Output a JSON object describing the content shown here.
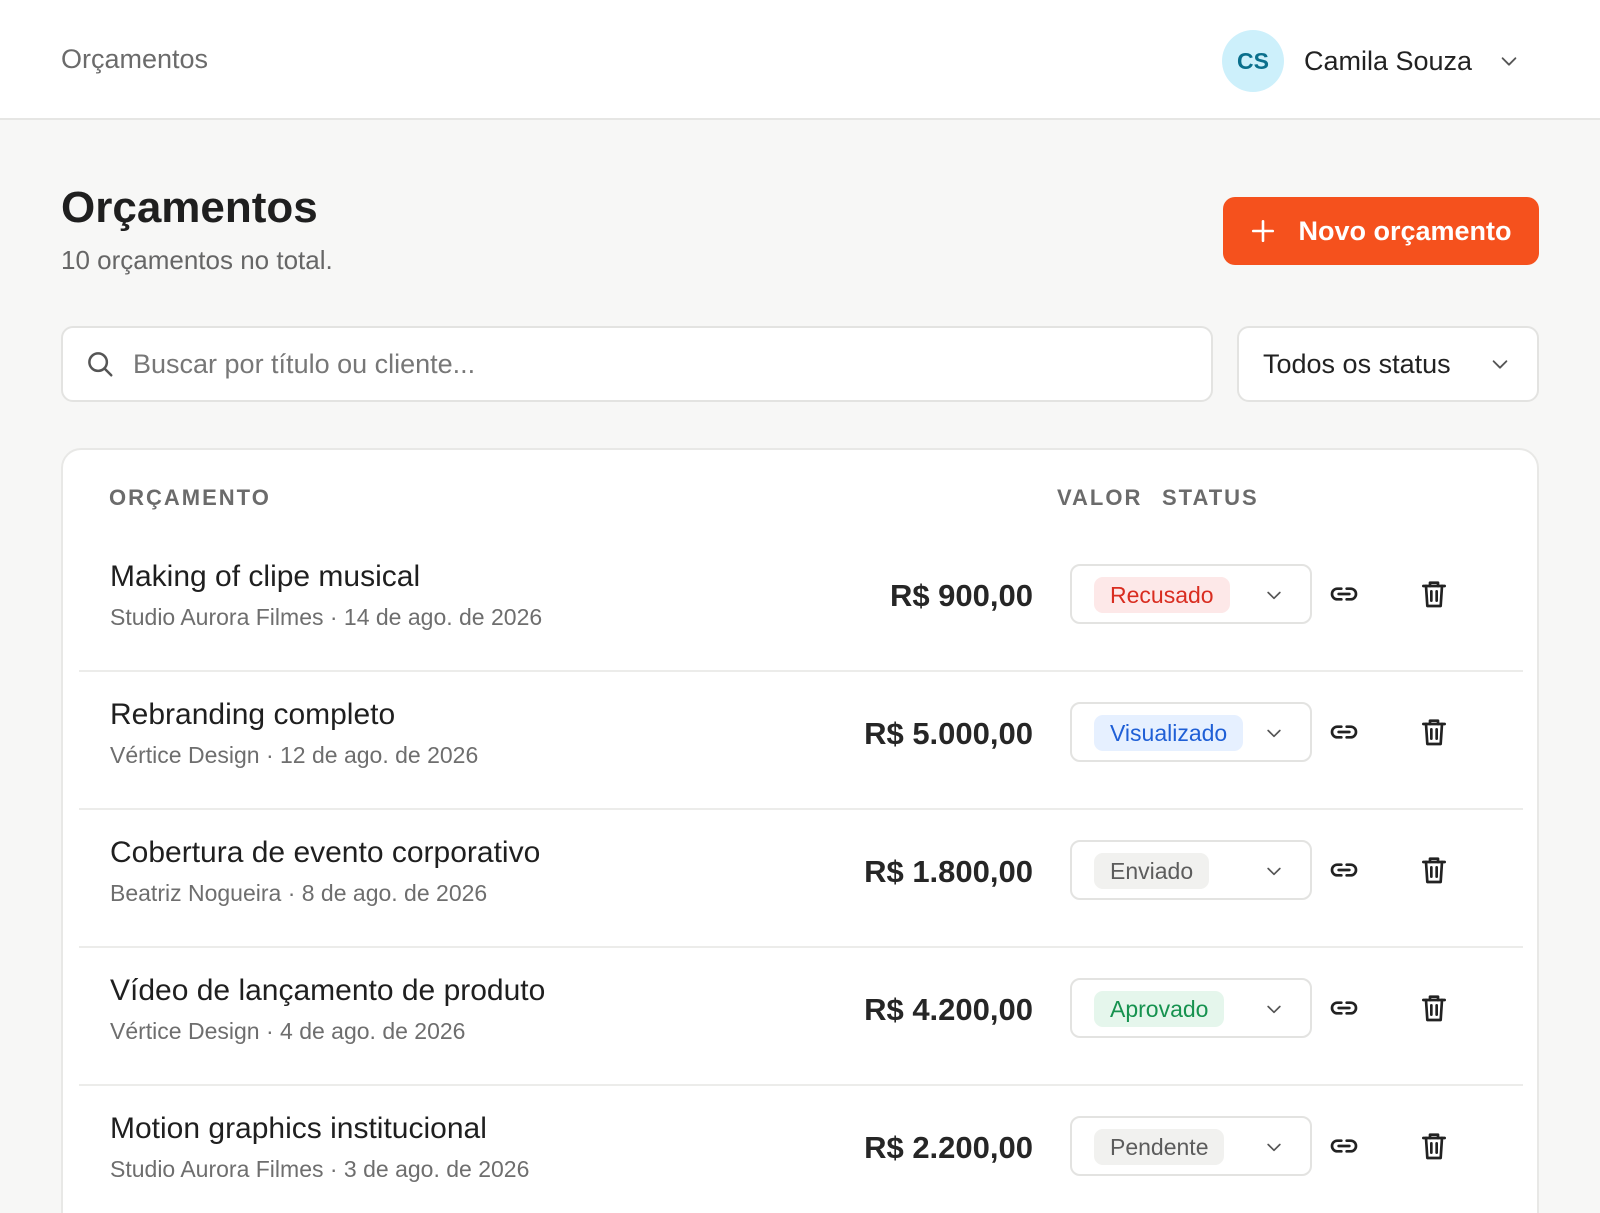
{
  "topbar": {
    "breadcrumb": "Orçamentos",
    "user": {
      "initials": "CS",
      "name": "Camila Souza"
    }
  },
  "header": {
    "title": "Orçamentos",
    "subtitle": "10 orçamentos no total.",
    "new_button_label": "Novo orçamento"
  },
  "filters": {
    "search_placeholder": "Buscar por título ou cliente...",
    "status_selected": "Todos os status"
  },
  "table": {
    "columns": {
      "quote": "ORÇAMENTO",
      "value": "VALOR",
      "status": "STATUS"
    },
    "rows": [
      {
        "title": "Making of clipe musical",
        "meta": "Studio Aurora Filmes · 14 de ago. de 2026",
        "value": "R$ 900,00",
        "status": "Recusado"
      },
      {
        "title": "Rebranding completo",
        "meta": "Vértice Design · 12 de ago. de 2026",
        "value": "R$ 5.000,00",
        "status": "Visualizado"
      },
      {
        "title": "Cobertura de evento corporativo",
        "meta": "Beatriz Nogueira · 8 de ago. de 2026",
        "value": "R$ 1.800,00",
        "status": "Enviado"
      },
      {
        "title": "Vídeo de lançamento de produto",
        "meta": "Vértice Design · 4 de ago. de 2026",
        "value": "R$ 4.200,00",
        "status": "Aprovado"
      },
      {
        "title": "Motion graphics institucional",
        "meta": "Studio Aurora Filmes · 3 de ago. de 2026",
        "value": "R$ 2.200,00",
        "status": "Pendente"
      }
    ]
  },
  "status_colors": {
    "Recusado": {
      "bg": "#fde8e8",
      "fg": "#d92d20"
    },
    "Visualizado": {
      "bg": "#e6f0ff",
      "fg": "#1f5fd6"
    },
    "Enviado": {
      "bg": "#f1f1ef",
      "fg": "#5c5c5c"
    },
    "Aprovado": {
      "bg": "#e5f6ec",
      "fg": "#16924f"
    },
    "Pendente": {
      "bg": "#f1f1ef",
      "fg": "#5c5c5c"
    }
  },
  "icons": {
    "user_menu": "chevron-down-icon",
    "new_button": "plus-icon",
    "search": "search-icon",
    "row_link": "link-icon",
    "row_delete": "trash-icon"
  },
  "accent_color": "#f5511d"
}
